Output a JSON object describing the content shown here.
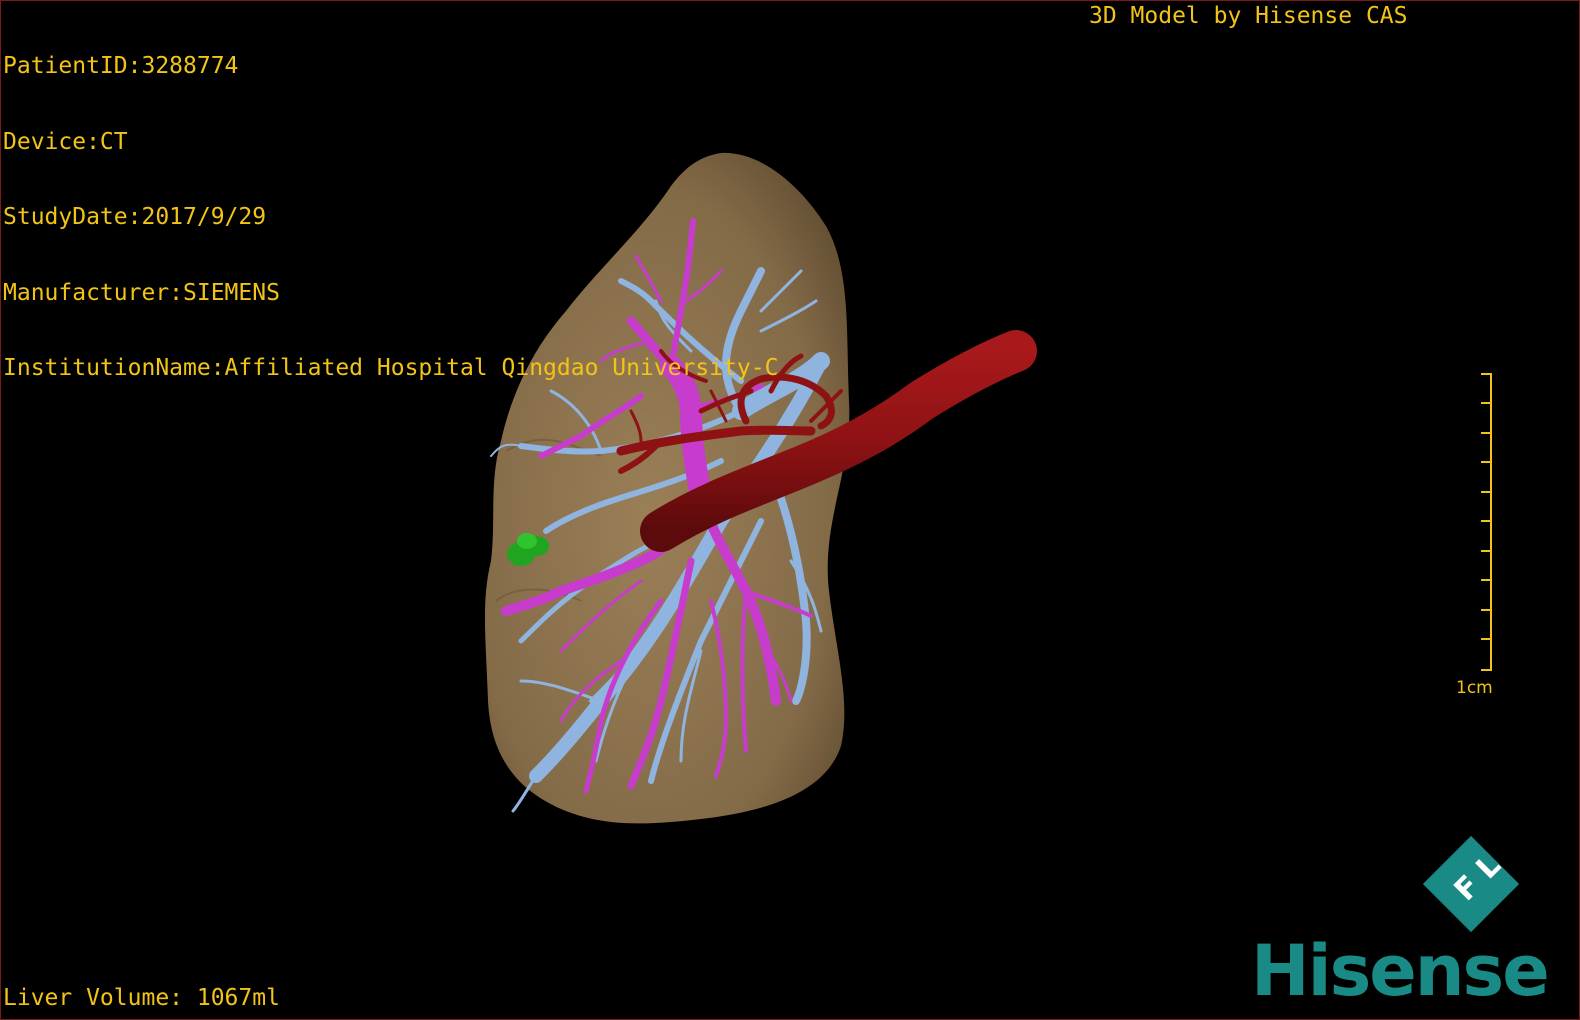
{
  "header": {
    "patient_id": "PatientID:3288774",
    "device": "Device:CT",
    "study_date": "StudyDate:2017/9/29",
    "manufacturer": "Manufacturer:SIEMENS",
    "institution": "InstitutionName:Affiliated Hospital Qingdao University-C",
    "credit": "3D Model by Hisense CAS"
  },
  "footer": {
    "liver_volume": "Liver Volume: 1067ml"
  },
  "scale": {
    "label": "1cm"
  },
  "logo": {
    "brand": "Hisense",
    "mark": "F L"
  },
  "colors": {
    "text": "#f2c417",
    "liver": "#8b7350",
    "portal_vein": "#c83ccd",
    "hepatic_vein": "#8fb4e0",
    "artery": "#8e1214",
    "lesion": "#1fa51f",
    "brand": "#1a8a86"
  }
}
